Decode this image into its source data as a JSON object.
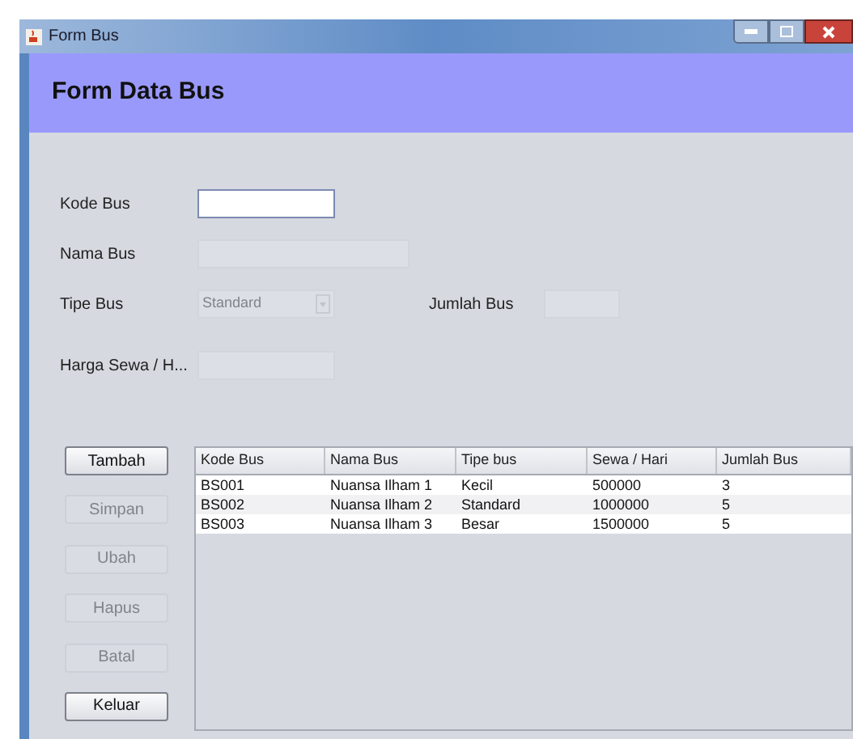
{
  "window": {
    "title": "Form Bus"
  },
  "header": {
    "title": "Form Data Bus"
  },
  "fields": [
    {
      "label": "Kode Bus",
      "kind": "text",
      "disabled": false
    },
    {
      "label": "Nama Bus",
      "kind": "text",
      "disabled": true
    },
    {
      "label": "Tipe Bus",
      "kind": "combo",
      "value": "Standard",
      "disabled": true,
      "side_label": "Jumlah Bus"
    },
    {
      "label": "Harga Sewa / H...",
      "kind": "text",
      "disabled": true
    }
  ],
  "buttons": [
    {
      "label": "Tambah",
      "disabled": false
    },
    {
      "label": "Simpan",
      "disabled": true
    },
    {
      "label": "Ubah",
      "disabled": true
    },
    {
      "label": "Hapus",
      "disabled": true
    },
    {
      "label": "Batal",
      "disabled": true
    },
    {
      "label": "Keluar",
      "disabled": false
    }
  ],
  "table": {
    "columns": [
      "Kode Bus",
      "Nama Bus",
      "Tipe bus",
      "Sewa / Hari",
      "Jumlah Bus"
    ],
    "rows": [
      [
        "BS001",
        "Nuansa Ilham 1",
        "Kecil",
        "500000",
        "3"
      ],
      [
        "BS002",
        "Nuansa Ilham 2",
        "Standard",
        "1000000",
        "5"
      ],
      [
        "BS003",
        "Nuansa Ilham 3",
        "Besar",
        "1500000",
        "5"
      ]
    ]
  }
}
